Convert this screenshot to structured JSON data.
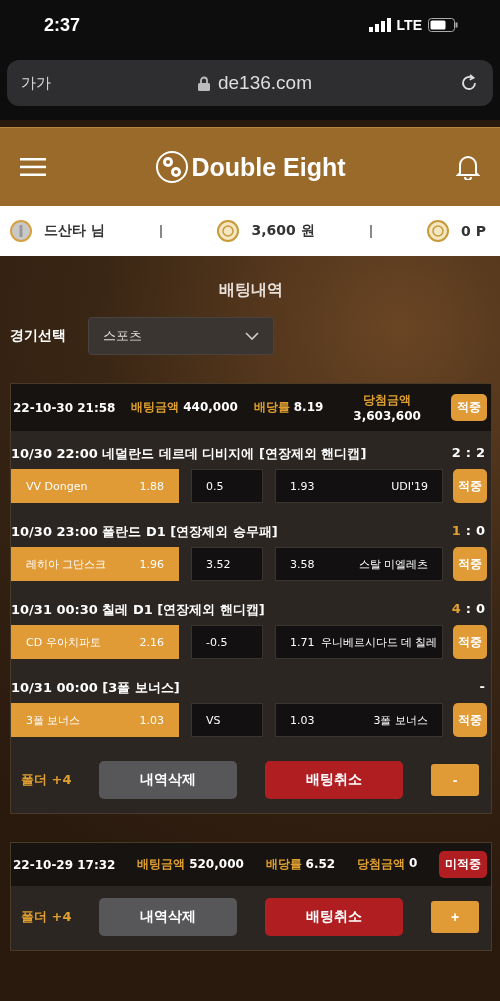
{
  "status_bar": {
    "time": "2:37",
    "network": "LTE"
  },
  "browser": {
    "text_size": "가가",
    "url": "de136.com"
  },
  "header": {
    "logo": "Double Eight"
  },
  "user_bar": {
    "name": "드산타 님",
    "money": "3,600 원",
    "points": "0 P"
  },
  "page_title": "배팅내역",
  "filter": {
    "label": "경기선택",
    "value": "스포츠"
  },
  "bets": [
    {
      "date": "22-10-30 21:58",
      "amount_label": "배팅금액",
      "amount": "440,000",
      "odds_label": "배당률",
      "odds": "8.19",
      "win_label": "당첨금액",
      "win": "3,603,600",
      "result": "적중",
      "kind": "hit",
      "expanded": true,
      "games": [
        {
          "title": "10/30 22:00 네덜란드 데르데 디비지에 [연장제외 핸디캡]",
          "score_home": "2",
          "score_sep": ":",
          "score_away": "2",
          "home_won": false,
          "home": {
            "name": "VV Dongen",
            "odds": "1.88",
            "selected": true
          },
          "middle": "0.5",
          "away": {
            "odds": "1.93",
            "name": "UDI'19",
            "selected": false
          },
          "result": "적중"
        },
        {
          "title": "10/30 23:00 폴란드 D1 [연장제외 승무패]",
          "score_home": "1",
          "score_sep": ":",
          "score_away": "0",
          "home_won": true,
          "home": {
            "name": "레히아 그단스크",
            "odds": "1.96",
            "selected": true
          },
          "middle": "3.52",
          "away": {
            "odds": "3.58",
            "name": "스탈 미엘레츠",
            "selected": false
          },
          "result": "적중"
        },
        {
          "title": "10/31 00:30 칠레 D1 [연장제외 핸디캡]",
          "score_home": "4",
          "score_sep": ":",
          "score_away": "0",
          "home_won": true,
          "home": {
            "name": "CD 우아치파토",
            "odds": "2.16",
            "selected": true
          },
          "middle": "-0.5",
          "away": {
            "odds": "1.71",
            "name": "우니베르시다드 데 칠레",
            "selected": false
          },
          "result": "적중"
        },
        {
          "title": "10/31 00:00 [3폴 보너스]",
          "score": "-",
          "home": {
            "name": "3폴 보너스",
            "odds": "1.03",
            "selected": true
          },
          "middle": "VS",
          "away": {
            "odds": "1.03",
            "name": "3폴 보너스",
            "selected": false
          },
          "result": "적중"
        }
      ],
      "folder": "폴더 +4",
      "delete_button": "내역삭제",
      "cancel_button": "배팅취소",
      "toggle": "-"
    },
    {
      "date": "22-10-29 17:32",
      "amount_label": "배팅금액",
      "amount": "520,000",
      "odds_label": "배당률",
      "odds": "6.52",
      "win_label": "당첨금액",
      "win": "0",
      "result": "미적중",
      "kind": "miss",
      "expanded": false,
      "folder": "폴더 +4",
      "delete_button": "내역삭제",
      "cancel_button": "배팅취소",
      "toggle": "+"
    }
  ]
}
